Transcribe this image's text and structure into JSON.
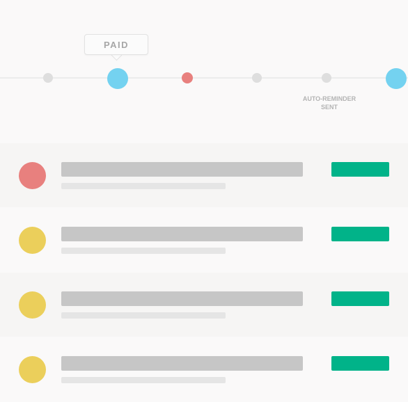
{
  "timeline": {
    "tooltip_label": "PAID",
    "auto_reminder_label_line1": "AUTO-REMINDER",
    "auto_reminder_label_line2": "SENT"
  },
  "colors": {
    "accent_blue": "#74d2f0",
    "overdue_red": "#e8807e",
    "pending_yellow": "#ebcf5b",
    "action_green": "#01b389"
  },
  "list": {
    "rows": [
      {
        "status": "overdue",
        "avatar_color": "#e8807e"
      },
      {
        "status": "pending",
        "avatar_color": "#ebcf5b"
      },
      {
        "status": "pending",
        "avatar_color": "#ebcf5b"
      },
      {
        "status": "pending",
        "avatar_color": "#ebcf5b"
      }
    ]
  }
}
